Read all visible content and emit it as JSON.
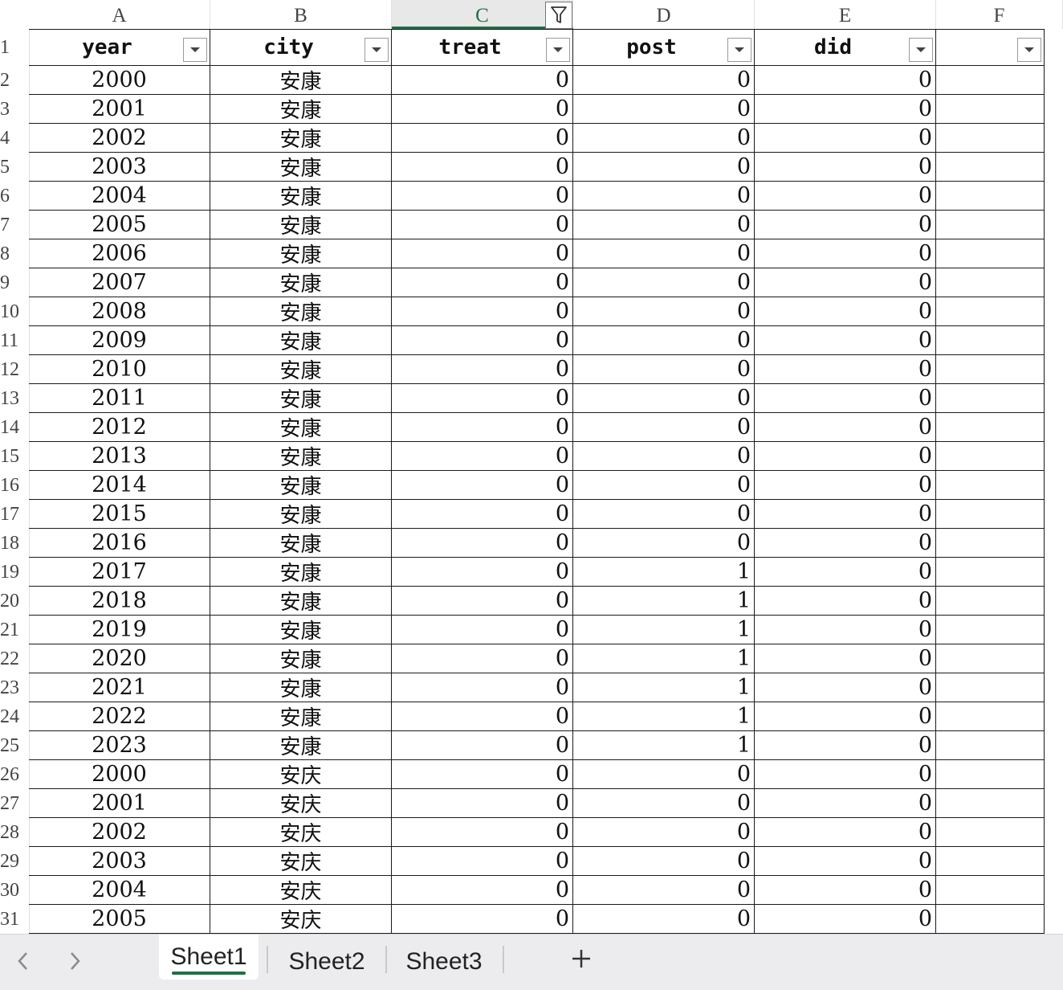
{
  "columns": [
    {
      "letter": "A",
      "header": "year"
    },
    {
      "letter": "B",
      "header": "city"
    },
    {
      "letter": "C",
      "header": "treat"
    },
    {
      "letter": "D",
      "header": "post"
    },
    {
      "letter": "E",
      "header": "did"
    },
    {
      "letter": "F",
      "header": ""
    }
  ],
  "active_column": "C",
  "header_row_number": "1",
  "rows": [
    {
      "n": "2",
      "year": "2000",
      "city": "安康",
      "treat": "0",
      "post": "0",
      "did": "0"
    },
    {
      "n": "3",
      "year": "2001",
      "city": "安康",
      "treat": "0",
      "post": "0",
      "did": "0"
    },
    {
      "n": "4",
      "year": "2002",
      "city": "安康",
      "treat": "0",
      "post": "0",
      "did": "0"
    },
    {
      "n": "5",
      "year": "2003",
      "city": "安康",
      "treat": "0",
      "post": "0",
      "did": "0"
    },
    {
      "n": "6",
      "year": "2004",
      "city": "安康",
      "treat": "0",
      "post": "0",
      "did": "0"
    },
    {
      "n": "7",
      "year": "2005",
      "city": "安康",
      "treat": "0",
      "post": "0",
      "did": "0"
    },
    {
      "n": "8",
      "year": "2006",
      "city": "安康",
      "treat": "0",
      "post": "0",
      "did": "0"
    },
    {
      "n": "9",
      "year": "2007",
      "city": "安康",
      "treat": "0",
      "post": "0",
      "did": "0"
    },
    {
      "n": "10",
      "year": "2008",
      "city": "安康",
      "treat": "0",
      "post": "0",
      "did": "0"
    },
    {
      "n": "11",
      "year": "2009",
      "city": "安康",
      "treat": "0",
      "post": "0",
      "did": "0"
    },
    {
      "n": "12",
      "year": "2010",
      "city": "安康",
      "treat": "0",
      "post": "0",
      "did": "0"
    },
    {
      "n": "13",
      "year": "2011",
      "city": "安康",
      "treat": "0",
      "post": "0",
      "did": "0"
    },
    {
      "n": "14",
      "year": "2012",
      "city": "安康",
      "treat": "0",
      "post": "0",
      "did": "0"
    },
    {
      "n": "15",
      "year": "2013",
      "city": "安康",
      "treat": "0",
      "post": "0",
      "did": "0"
    },
    {
      "n": "16",
      "year": "2014",
      "city": "安康",
      "treat": "0",
      "post": "0",
      "did": "0"
    },
    {
      "n": "17",
      "year": "2015",
      "city": "安康",
      "treat": "0",
      "post": "0",
      "did": "0"
    },
    {
      "n": "18",
      "year": "2016",
      "city": "安康",
      "treat": "0",
      "post": "0",
      "did": "0"
    },
    {
      "n": "19",
      "year": "2017",
      "city": "安康",
      "treat": "0",
      "post": "1",
      "did": "0"
    },
    {
      "n": "20",
      "year": "2018",
      "city": "安康",
      "treat": "0",
      "post": "1",
      "did": "0"
    },
    {
      "n": "21",
      "year": "2019",
      "city": "安康",
      "treat": "0",
      "post": "1",
      "did": "0"
    },
    {
      "n": "22",
      "year": "2020",
      "city": "安康",
      "treat": "0",
      "post": "1",
      "did": "0"
    },
    {
      "n": "23",
      "year": "2021",
      "city": "安康",
      "treat": "0",
      "post": "1",
      "did": "0"
    },
    {
      "n": "24",
      "year": "2022",
      "city": "安康",
      "treat": "0",
      "post": "1",
      "did": "0"
    },
    {
      "n": "25",
      "year": "2023",
      "city": "安康",
      "treat": "0",
      "post": "1",
      "did": "0"
    },
    {
      "n": "26",
      "year": "2000",
      "city": "安庆",
      "treat": "0",
      "post": "0",
      "did": "0"
    },
    {
      "n": "27",
      "year": "2001",
      "city": "安庆",
      "treat": "0",
      "post": "0",
      "did": "0"
    },
    {
      "n": "28",
      "year": "2002",
      "city": "安庆",
      "treat": "0",
      "post": "0",
      "did": "0"
    },
    {
      "n": "29",
      "year": "2003",
      "city": "安庆",
      "treat": "0",
      "post": "0",
      "did": "0"
    },
    {
      "n": "30",
      "year": "2004",
      "city": "安庆",
      "treat": "0",
      "post": "0",
      "did": "0"
    },
    {
      "n": "31",
      "year": "2005",
      "city": "安庆",
      "treat": "0",
      "post": "0",
      "did": "0"
    }
  ],
  "tabs": [
    {
      "label": "Sheet1",
      "active": true
    },
    {
      "label": "Sheet2",
      "active": false
    },
    {
      "label": "Sheet3",
      "active": false
    }
  ],
  "icons": {
    "prev": "chevron-left-icon",
    "next": "chevron-right-icon",
    "add": "plus-icon",
    "filter": "filter-funnel-icon",
    "dropdown": "dropdown-arrow-icon"
  },
  "colors": {
    "accent": "#1e7145",
    "active_column_bg": "#e8e8e8",
    "tabbar_bg": "#ececee"
  }
}
